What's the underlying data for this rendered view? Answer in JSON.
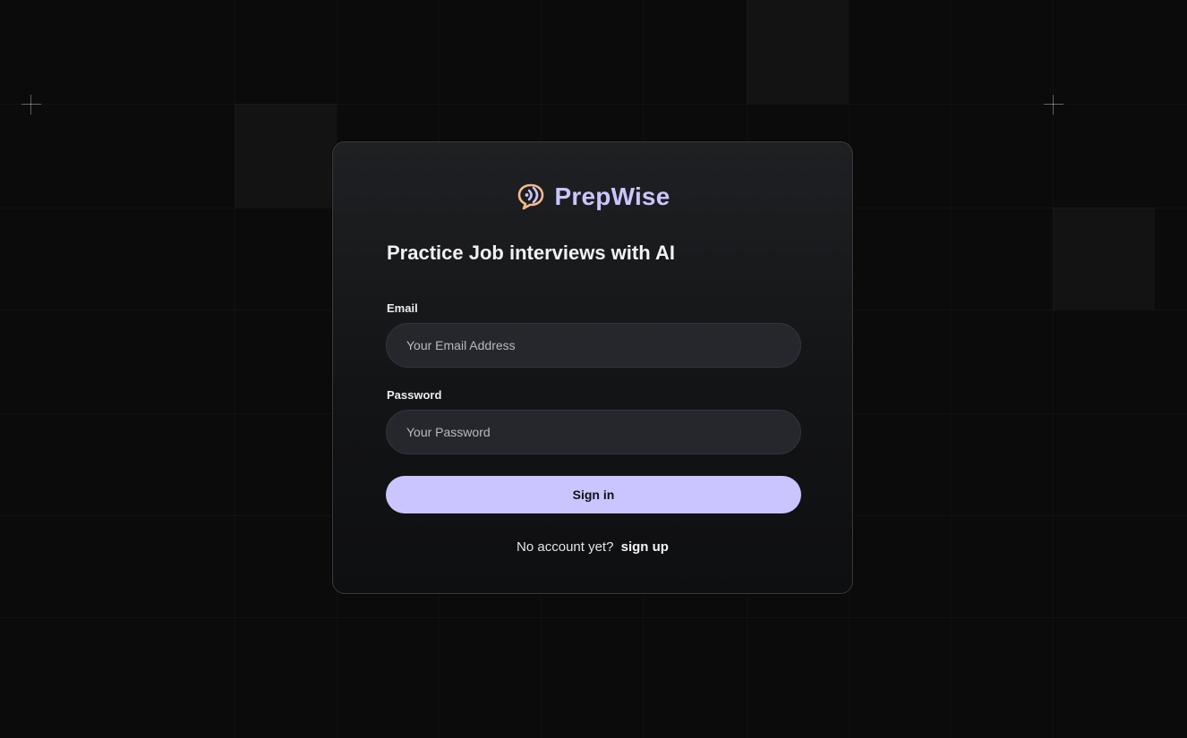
{
  "brand": {
    "name": "PrepWise",
    "icon": "chat-bubble-sound-icon",
    "color": "#cac5fe",
    "icon_accent": "#f5b98a"
  },
  "tagline": "Practice Job interviews with AI",
  "form": {
    "email": {
      "label": "Email",
      "placeholder": "Your Email Address",
      "value": ""
    },
    "password": {
      "label": "Password",
      "placeholder": "Your Password",
      "value": ""
    },
    "submit_label": "Sign in"
  },
  "footer": {
    "prompt": "No account yet?",
    "link_label": "sign up"
  },
  "colors": {
    "background": "#0b0b0b",
    "card_border": "#3a3a40",
    "input_background": "#26272c",
    "button_background": "#cac5fe"
  }
}
